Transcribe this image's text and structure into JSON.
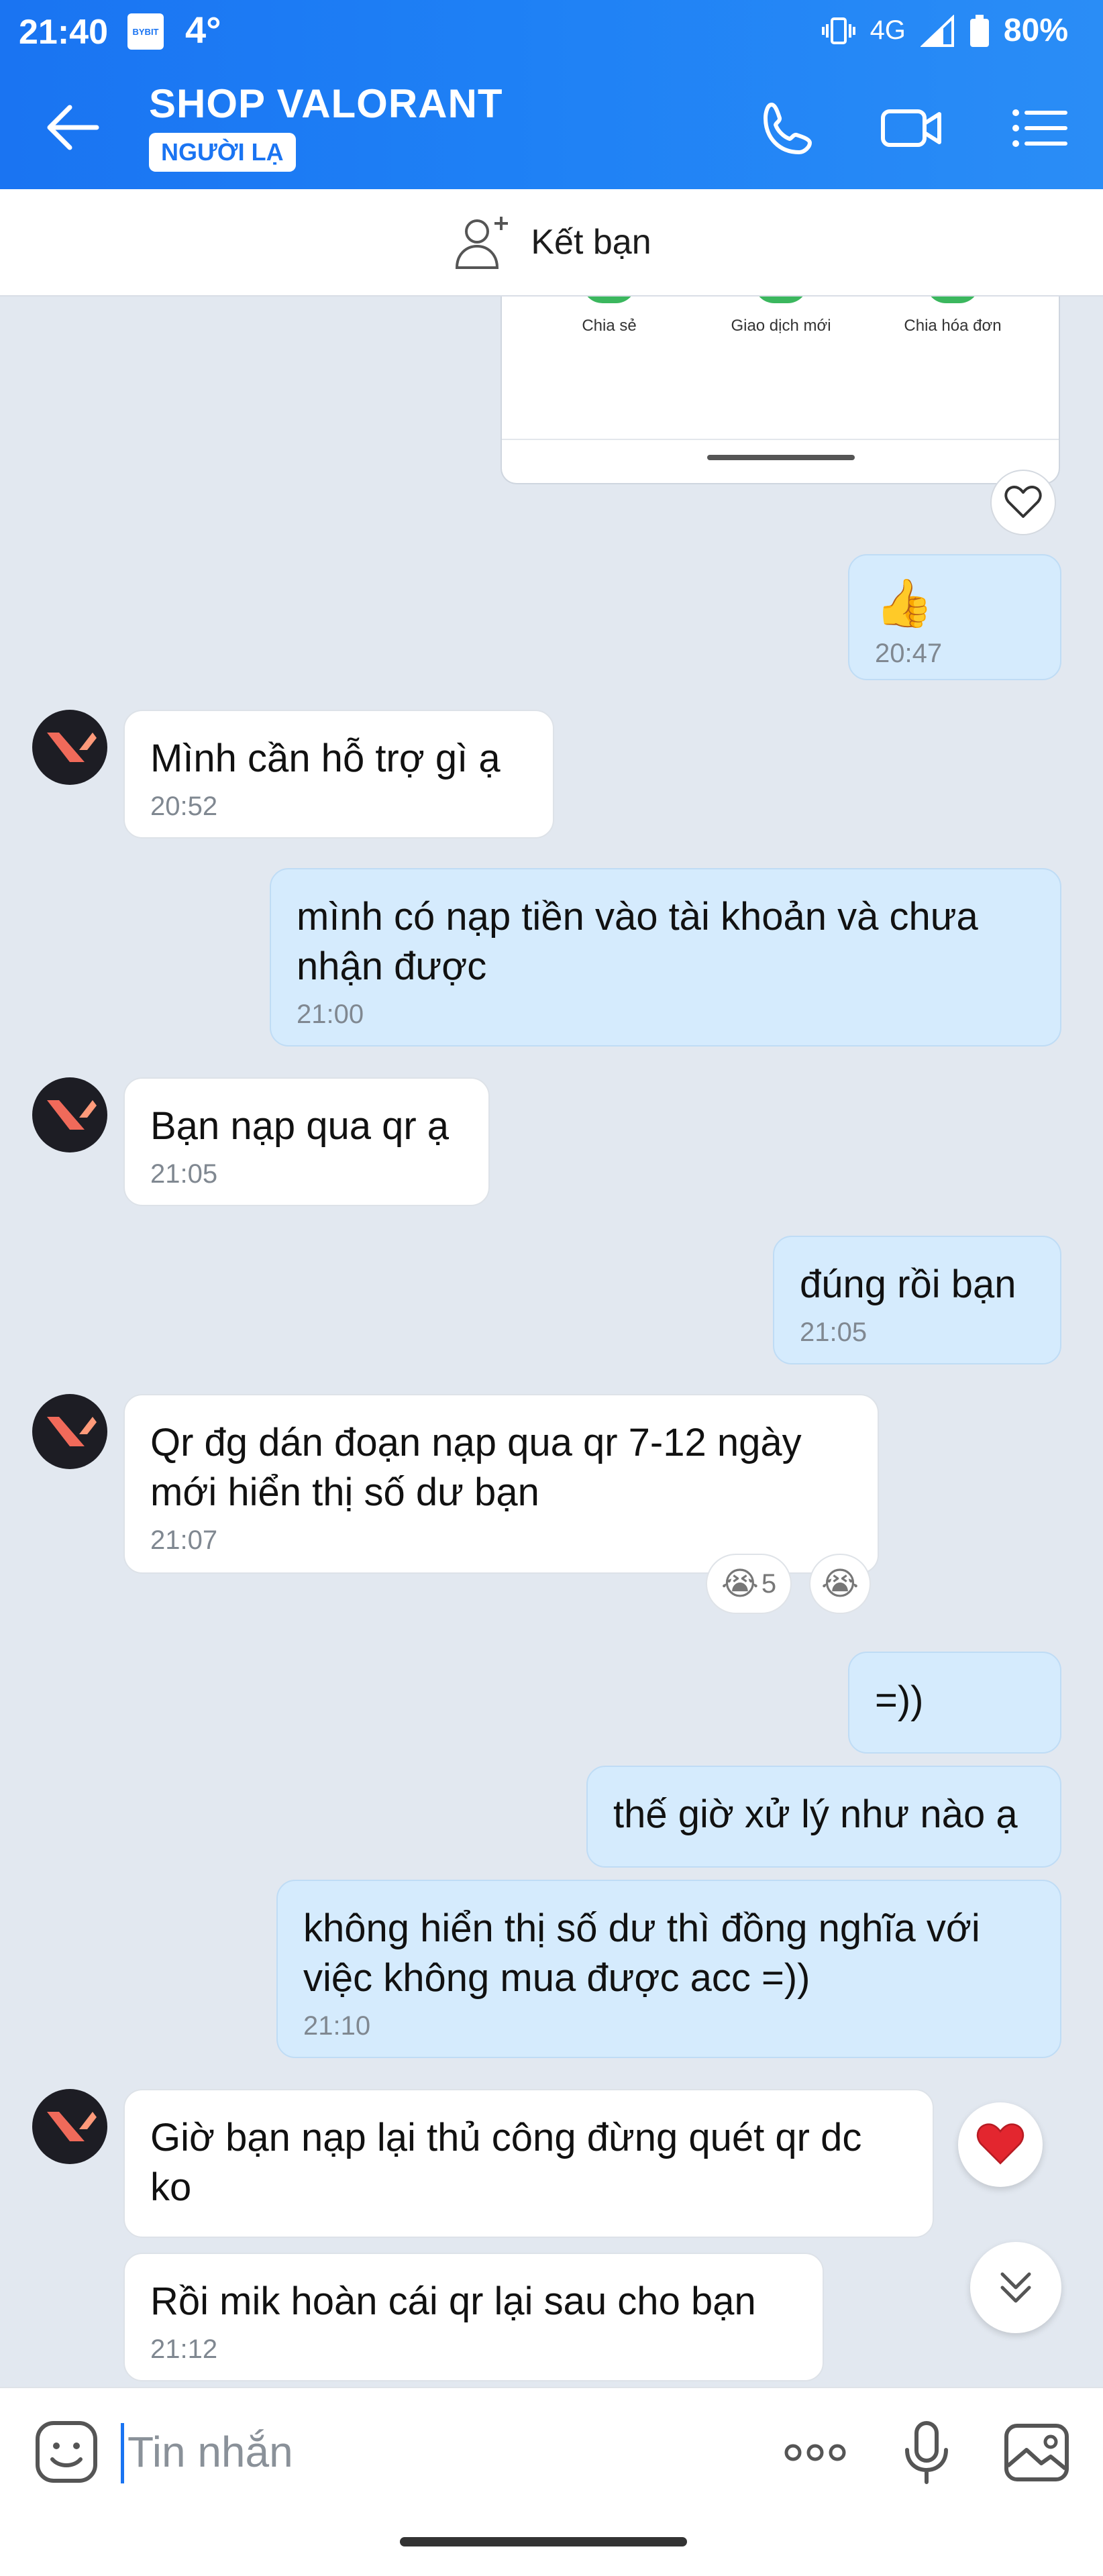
{
  "status_bar": {
    "time": "21:40",
    "app_badge": "BYBIT",
    "temperature": "4°",
    "network": "4G",
    "battery": "80%"
  },
  "header": {
    "title": "SHOP VALORANT",
    "badge": "NGƯỜI LẠ"
  },
  "add_friend": {
    "label": "Kết bạn"
  },
  "shared_card": {
    "actions": [
      "Chia sẻ",
      "Giao dịch mới",
      "Chia hóa đơn"
    ]
  },
  "messages": [
    {
      "dir": "out",
      "emoji": "👍",
      "time": "20:47"
    },
    {
      "dir": "in",
      "text": "Mình cần hỗ trợ gì ạ",
      "time": "20:52"
    },
    {
      "dir": "out",
      "text": "mình có nạp tiền vào tài khoản và chưa nhận được",
      "time": "21:00"
    },
    {
      "dir": "in",
      "text": "Bạn nạp qua qr ạ",
      "time": "21:05"
    },
    {
      "dir": "out",
      "text": "đúng rồi bạn",
      "time": "21:05"
    },
    {
      "dir": "in",
      "text": "Qr đg dán đoạn nạp qua qr 7-12 ngày mới hiển thị số dư bạn",
      "time": "21:07",
      "reaction_count": "5"
    },
    {
      "dir": "out",
      "text": "=))"
    },
    {
      "dir": "out",
      "text": "thế giờ xử lý như nào ạ"
    },
    {
      "dir": "out",
      "text": "không hiển thị số dư thì đồng nghĩa với việc không mua được acc =))",
      "time": "21:10"
    },
    {
      "dir": "in",
      "text": "Giờ bạn nạp lại thủ công đừng quét qr dc ko"
    },
    {
      "dir": "in",
      "text": "Rồi mik hoàn cái qr lại sau cho bạn",
      "time": "21:12"
    }
  ],
  "composer": {
    "placeholder": "Tin nhắn"
  },
  "colors": {
    "header": "#1a74f2",
    "outgoing_bubble": "#d5ebfd",
    "incoming_bubble": "#ffffff",
    "chat_bg": "#e2e8f0",
    "heart": "#e3262f"
  }
}
